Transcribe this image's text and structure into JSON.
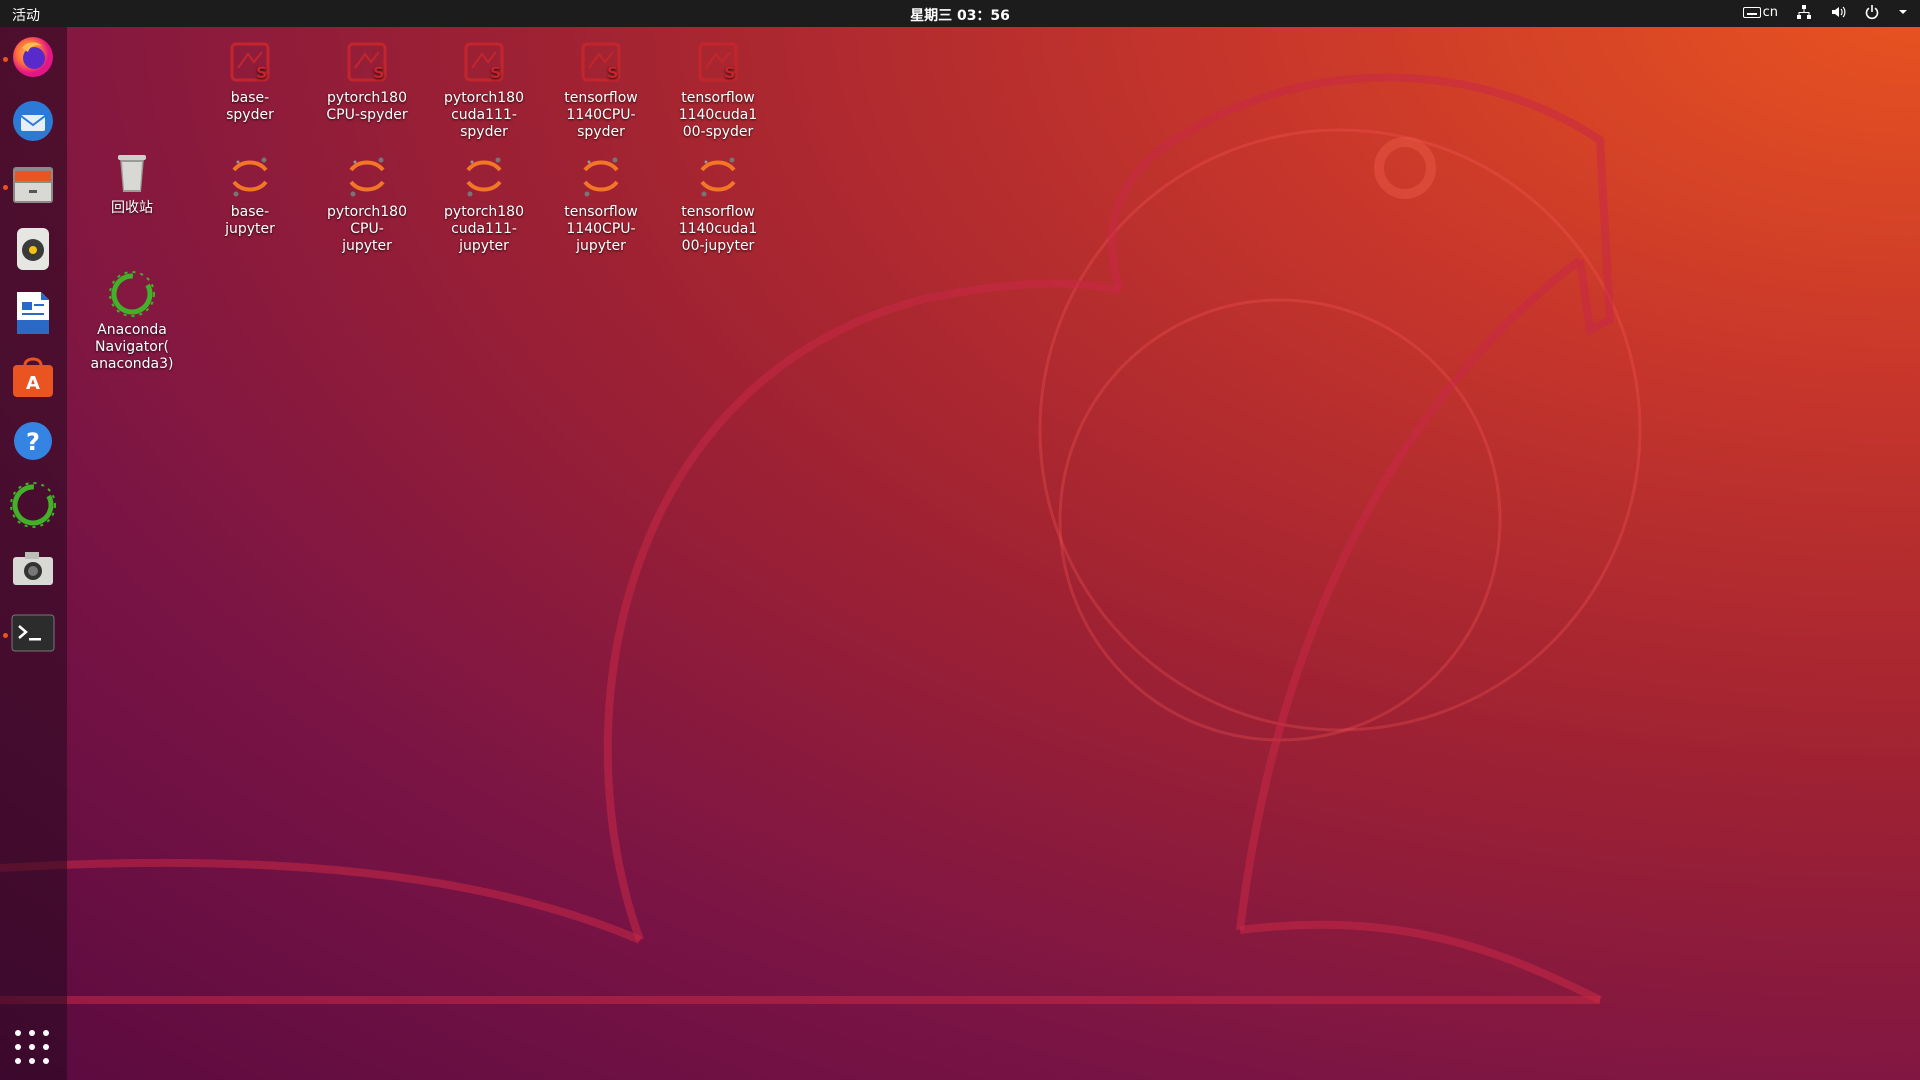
{
  "topbar": {
    "activities": "活动",
    "clock": "星期三 03：56",
    "input_method": "cn",
    "icons": [
      "keyboard-icon",
      "network-icon",
      "volume-icon",
      "power-icon",
      "chevron-down-icon"
    ]
  },
  "dock": {
    "apps": [
      {
        "name": "firefox",
        "running": true
      },
      {
        "name": "thunderbird",
        "running": false
      },
      {
        "name": "files",
        "running": true
      },
      {
        "name": "rhythmbox",
        "running": false
      },
      {
        "name": "libreoffice-writer",
        "running": false
      },
      {
        "name": "ubuntu-software",
        "running": false
      },
      {
        "name": "help",
        "running": false
      },
      {
        "name": "anaconda-navigator",
        "running": false
      },
      {
        "name": "screenshot",
        "running": false
      },
      {
        "name": "terminal",
        "running": true
      }
    ],
    "show_apps_icon": "grid-icon"
  },
  "desktop": {
    "trash": "回收站",
    "navigator": "Anaconda\nNavigator(\nanaconda3)",
    "spyder": [
      "base-\nspyder",
      "pytorch180\nCPU-spyder",
      "pytorch180\ncuda111-\nspyder",
      "tensorflow\n1140CPU-\nspyder",
      "tensorflow\n1140cuda1\n00-spyder"
    ],
    "jupyter": [
      "base-\njupyter",
      "pytorch180\nCPU-\njupyter",
      "pytorch180\ncuda111-\njupyter",
      "tensorflow\n1140CPU-\njupyter",
      "tensorflow\n1140cuda1\n00-jupyter"
    ]
  },
  "colors": {
    "accent": "#e95420",
    "topbar_bg": "#1c1c1c",
    "anaconda_green": "#43b02a",
    "spyder_red": "#c4252d"
  }
}
